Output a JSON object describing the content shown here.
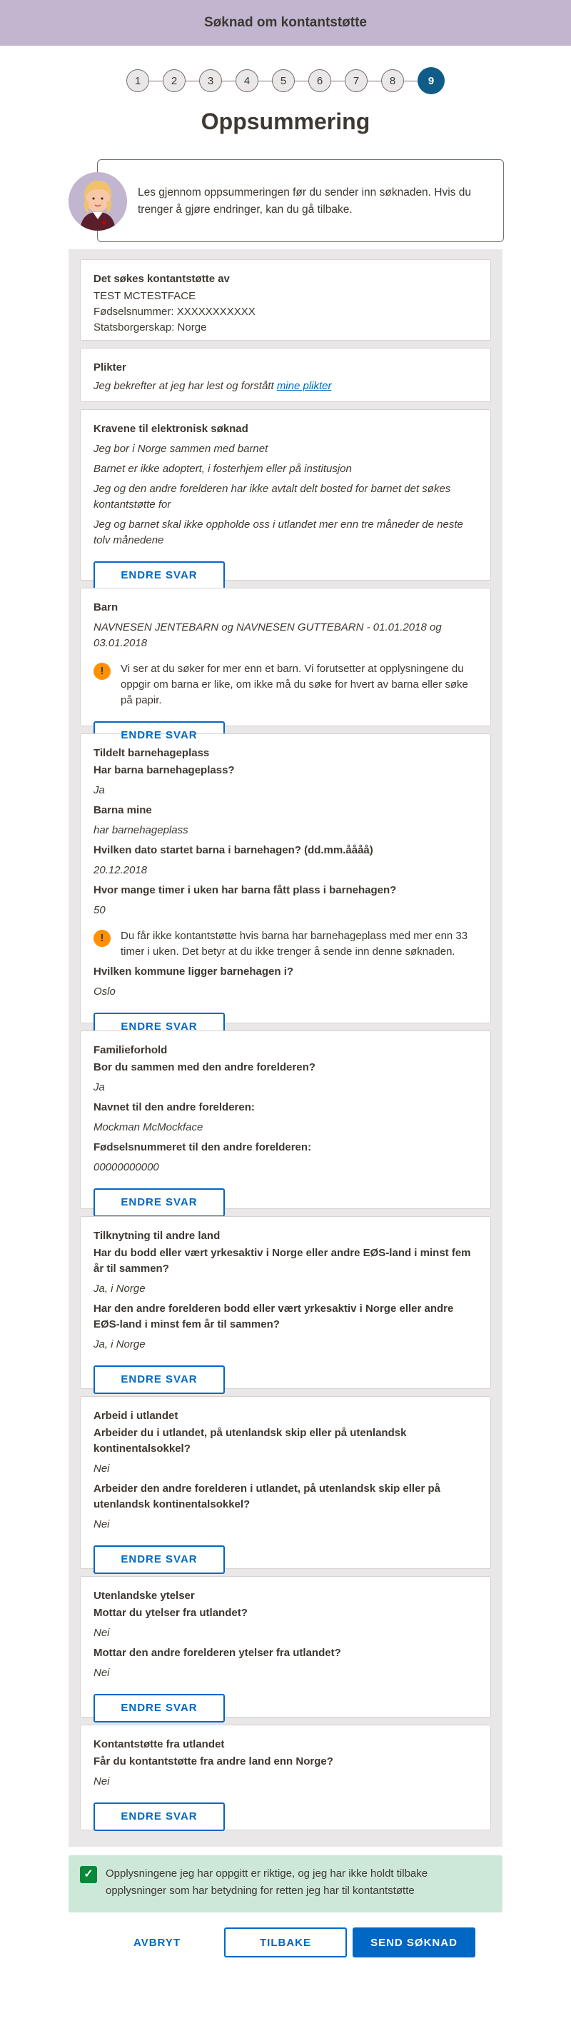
{
  "header": {
    "title": "Søknad om kontantstøtte"
  },
  "steps": [
    "1",
    "2",
    "3",
    "4",
    "5",
    "6",
    "7",
    "8",
    "9"
  ],
  "page_title": "Oppsummering",
  "veileder_text": "Les gjennom oppsummeringen før du sender inn søknaden. Hvis du trenger å gjøre endringer, kan du gå tilbake.",
  "edit_label": "ENDRE SVAR",
  "soker": {
    "heading": "Det søkes kontantstøtte av",
    "name": "TEST MCTESTFACE",
    "fnr": "Fødselsnummer: XXXXXXXXXXX",
    "statsborgerskap": "Statsborgerskap: Norge"
  },
  "plikter": {
    "heading": "Plikter",
    "text": "Jeg bekrefter at jeg har lest og forstått",
    "link": "mine plikter"
  },
  "krav": {
    "heading": "Kravene til elektronisk søknad",
    "items": [
      "Jeg bor i Norge sammen med barnet",
      "Barnet er ikke adoptert, i fosterhjem eller på institusjon",
      "Jeg og den andre forelderen har ikke avtalt delt bosted for barnet det søkes kontantstøtte for",
      "Jeg og barnet skal ikke oppholde oss i utlandet mer enn tre måneder de neste tolv månedene"
    ]
  },
  "barn": {
    "heading": "Barn",
    "value": "NAVNESEN JENTEBARN og NAVNESEN GUTTEBARN - 01.01.2018 og 03.01.2018",
    "alert": "Vi ser at du søker for mer enn et barn. Vi forutsetter at opplysningene du oppgir om barna er like, om ikke må du søke for hvert av barna eller søke på papir."
  },
  "barnehage": {
    "heading": "Tildelt barnehageplass",
    "q1": "Har barna barnehageplass?",
    "a1": "Ja",
    "q2": "Barna mine",
    "a2": "har barnehageplass",
    "q3": "Hvilken dato startet barna i barnehagen? (dd.mm.åååå)",
    "a3": "20.12.2018",
    "q4": "Hvor mange timer i uken har barna fått plass i barnehagen?",
    "a4": "50",
    "alert": "Du får ikke kontantstøtte hvis barna har barnehageplass med mer enn 33 timer i uken. Det betyr at du ikke trenger å sende inn denne søknaden.",
    "q5": "Hvilken kommune ligger barnehagen i?",
    "a5": "Oslo"
  },
  "familie": {
    "heading": "Familieforhold",
    "q1": "Bor du sammen med den andre forelderen?",
    "a1": "Ja",
    "q2": "Navnet til den andre forelderen:",
    "a2": "Mockman McMockface",
    "q3": "Fødselsnummeret til den andre forelderen:",
    "a3": "00000000000"
  },
  "tilknytning": {
    "heading": "Tilknytning til andre land",
    "q1": "Har du bodd eller vært yrkesaktiv i Norge eller andre EØS-land i minst fem år til sammen?",
    "a1": "Ja, i Norge",
    "q2": "Har den andre forelderen bodd eller vært yrkesaktiv i Norge eller andre EØS-land i minst fem år til sammen?",
    "a2": "Ja, i Norge"
  },
  "arbeid": {
    "heading": "Arbeid i utlandet",
    "q1": "Arbeider du i utlandet, på utenlandsk skip eller på utenlandsk kontinentalsokkel?",
    "a1": "Nei",
    "q2": "Arbeider den andre forelderen i utlandet, på utenlandsk skip eller på utenlandsk kontinentalsokkel?",
    "a2": "Nei"
  },
  "ytelser": {
    "heading": "Utenlandske ytelser",
    "q1": "Mottar du ytelser fra utlandet?",
    "a1": "Nei",
    "q2": "Mottar den andre forelderen ytelser fra utlandet?",
    "a2": "Nei"
  },
  "kontantstotte_utland": {
    "heading": "Kontantstøtte fra utlandet",
    "q1": "Får du kontantstøtte fra andre land enn Norge?",
    "a1": "Nei"
  },
  "bekreftelse": "Opplysningene jeg har oppgitt er riktige, og jeg har ikke holdt tilbake opplysninger som har betydning for retten jeg har til kontantstøtte",
  "buttons": {
    "avbryt": "AVBRYT",
    "tilbake": "TILBAKE",
    "send": "SEND SØKNAD"
  }
}
